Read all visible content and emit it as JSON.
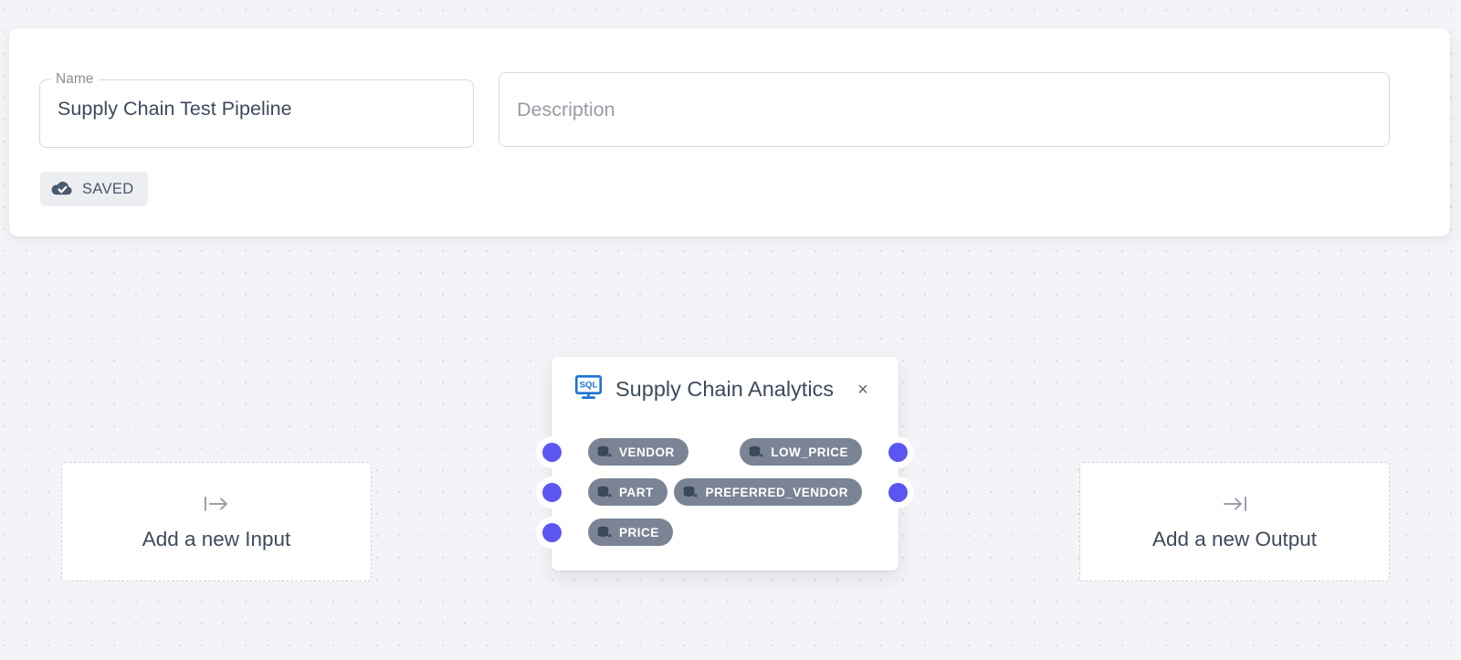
{
  "header": {
    "name_label": "Name",
    "name_value": "Supply Chain Test Pipeline",
    "name_placeholder": "Name",
    "description_value": "",
    "description_placeholder": "Description",
    "status_badge": {
      "label": "SAVED",
      "icon": "cloud-check-icon",
      "bg": "#eceef1",
      "icon_color": "#4a5a6e"
    }
  },
  "canvas": {
    "input_placeholder": {
      "label": "Add a new Input",
      "icon": "arrow-from-bar-right-icon"
    },
    "output_placeholder": {
      "label": "Add a new Output",
      "icon": "arrow-to-bar-right-icon"
    },
    "node": {
      "icon": "sql-monitor-icon",
      "icon_color": "#1a73d4",
      "title": "Supply Chain Analytics",
      "close_label": "×",
      "handle_color": "#5b56f0",
      "chip_color": "#7a8494",
      "rows": [
        {
          "input": {
            "label": "VENDOR",
            "icon": "database-icon",
            "handle": "input-handle"
          },
          "output": {
            "label": "LOW_PRICE",
            "icon": "database-icon",
            "handle": "output-handle"
          }
        },
        {
          "input": {
            "label": "PART",
            "icon": "database-icon",
            "handle": "input-handle"
          },
          "output": {
            "label": "PREFERRED_VENDOR",
            "icon": "database-icon",
            "handle": "output-handle"
          }
        },
        {
          "input": {
            "label": "PRICE",
            "icon": "database-icon",
            "handle": "input-handle"
          },
          "output": null
        }
      ]
    }
  }
}
